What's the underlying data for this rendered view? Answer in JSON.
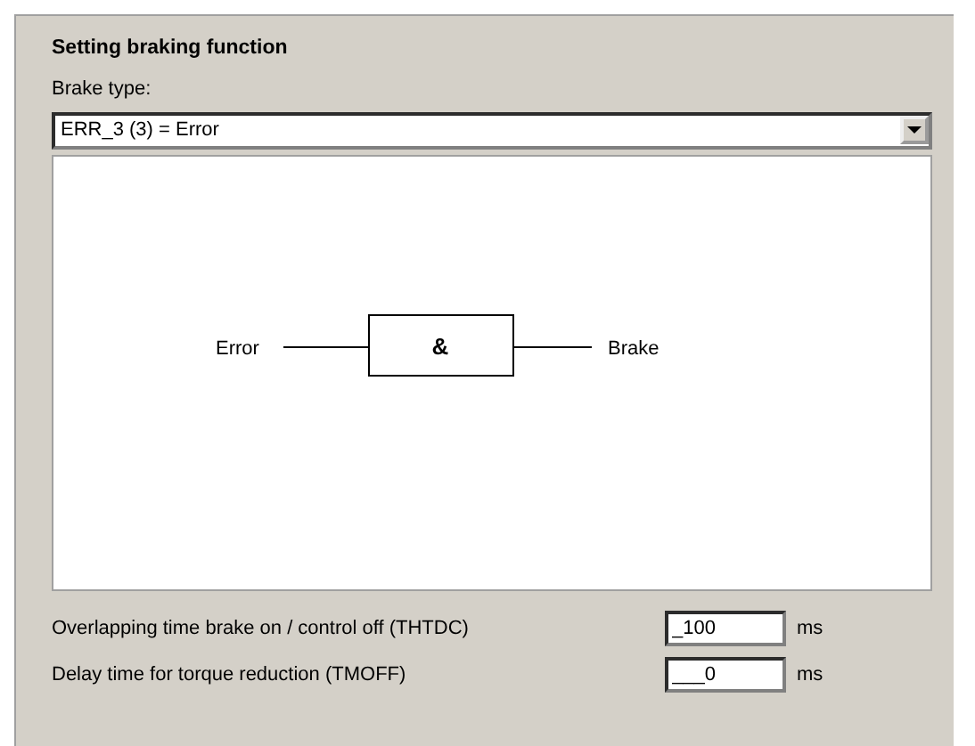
{
  "section_title": "Setting braking function",
  "brake_type": {
    "label": "Brake type:",
    "value": "ERR_3 (3) = Error"
  },
  "diagram": {
    "input": "Error",
    "gate": "&",
    "output": "Brake"
  },
  "parameters": [
    {
      "label": "Overlapping time brake on / control off (THTDC)",
      "value": "_100",
      "unit": "ms"
    },
    {
      "label": "Delay time for torque reduction (TMOFF)",
      "value": "___0",
      "unit": "ms"
    }
  ]
}
